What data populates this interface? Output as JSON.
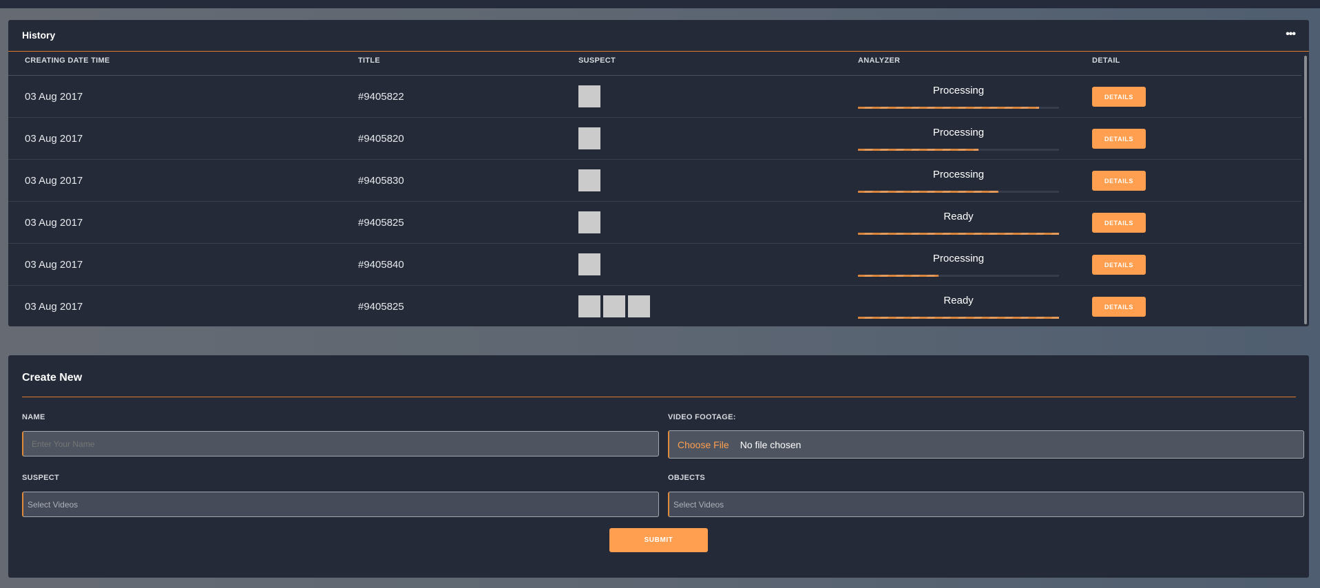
{
  "history": {
    "title": "History",
    "more_icon": "ellipsis-icon",
    "columns": [
      "CREATING DATE TIME",
      "TITLE",
      "SUSPECT",
      "ANALYZER",
      "DETAIL"
    ],
    "rows": [
      {
        "date": "03 Aug 2017",
        "title": "#9405822",
        "suspects": 1,
        "status": "Processing",
        "progress": 0.9,
        "detail": "DETAILS"
      },
      {
        "date": "03 Aug 2017",
        "title": "#9405820",
        "suspects": 1,
        "status": "Processing",
        "progress": 0.6,
        "detail": "DETAILS"
      },
      {
        "date": "03 Aug 2017",
        "title": "#9405830",
        "suspects": 1,
        "status": "Processing",
        "progress": 0.7,
        "detail": "DETAILS"
      },
      {
        "date": "03 Aug 2017",
        "title": "#9405825",
        "suspects": 1,
        "status": "Ready",
        "progress": 1.0,
        "detail": "DETAILS"
      },
      {
        "date": "03 Aug 2017",
        "title": "#9405840",
        "suspects": 1,
        "status": "Processing",
        "progress": 0.4,
        "detail": "DETAILS"
      },
      {
        "date": "03 Aug 2017",
        "title": "#9405825",
        "suspects": 3,
        "status": "Ready",
        "progress": 1.0,
        "detail": "DETAILS"
      }
    ]
  },
  "create": {
    "title": "Create New",
    "name_label": "NAME",
    "name_placeholder": "Enter Your Name",
    "video_label": "VIDEO FOOTAGE:",
    "choose_file": "Choose File",
    "no_file": "No file chosen",
    "suspect_label": "SUSPECT",
    "suspect_placeholder": "Select Videos",
    "objects_label": "OBJECTS",
    "objects_placeholder": "Select Videos",
    "submit": "SUBMIT"
  },
  "colors": {
    "accent": "#ff9f4f",
    "card": "#242a38",
    "line": "#e07c2c"
  }
}
